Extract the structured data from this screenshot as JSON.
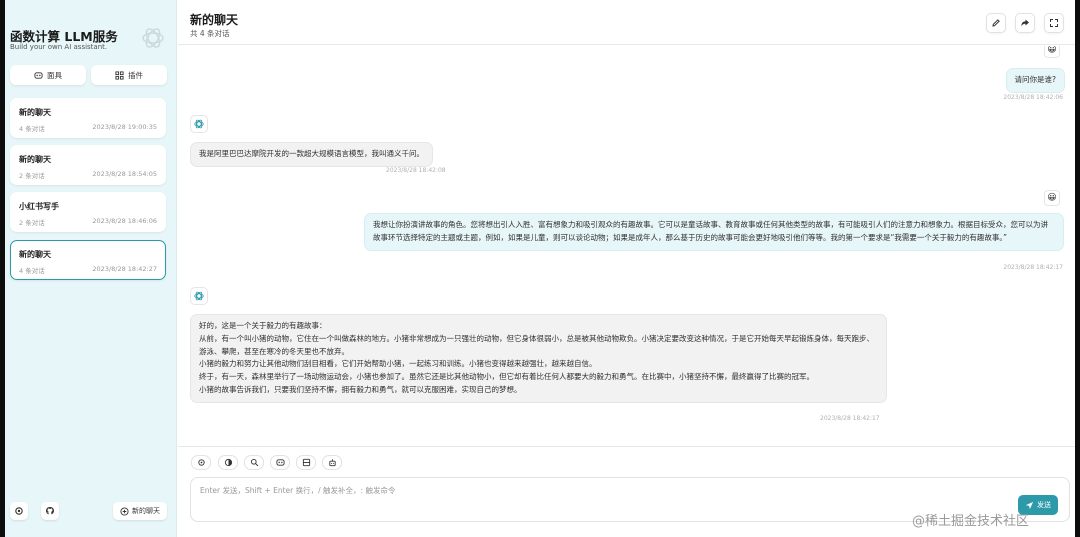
{
  "sidebar": {
    "title": "函数计算 LLM服务",
    "subtitle": "Build your own AI assistant.",
    "buttons": [
      {
        "label": "面具",
        "icon": "mask-icon"
      },
      {
        "label": "插件",
        "icon": "plugin-grid-icon"
      }
    ],
    "chats": [
      {
        "title": "新的聊天",
        "count": "4 条对话",
        "time": "2023/8/28 19:00:35",
        "active": false
      },
      {
        "title": "新的聊天",
        "count": "2 条对话",
        "time": "2023/8/28 18:54:05",
        "active": false
      },
      {
        "title": "小红书写手",
        "count": "2 条对话",
        "time": "2023/8/28 18:46:06",
        "active": false
      },
      {
        "title": "新的聊天",
        "count": "4 条对话",
        "time": "2023/8/28 18:42:27",
        "active": true
      }
    ],
    "new_chat_label": "新的聊天"
  },
  "header": {
    "title": "新的聊天",
    "subtitle": "共 4 条对话"
  },
  "messages": [
    {
      "role": "user",
      "avatar": "😀",
      "text": "请问你是谁?",
      "time": "2023/8/28 18:42:06"
    },
    {
      "role": "bot",
      "text": "我是阿里巴巴达摩院开发的一款超大规模语言模型，我叫通义千问。",
      "time": "2023/8/28 18:42:08"
    },
    {
      "role": "user",
      "avatar": "😀",
      "text": "我想让你扮演讲故事的角色。您将想出引人入胜、富有想象力和吸引观众的有趣故事。它可以是童话故事、教育故事或任何其他类型的故事，有可能吸引人们的注意力和想象力。根据目标受众，您可以为讲故事环节选择特定的主题或主题，例如，如果是儿童，则可以谈论动物；如果是成年人，那么基于历史的故事可能会更好地吸引他们等等。我的第一个要求是“我需要一个关于毅力的有趣故事。”",
      "time": "2023/8/28 18:42:17"
    },
    {
      "role": "bot",
      "lines": [
        "好的，这是一个关于毅力的有趣故事：",
        "从前，有一个叫小猪的动物，它住在一个叫做森林的地方。小猪非常想成为一只强壮的动物，但它身体很弱小，总是被其他动物欺负。小猪决定要改变这种情况，于是它开始每天早起锻炼身体，每天跑步、游泳、攀爬，甚至在寒冷的冬天里也不放弃。",
        "小猪的毅力和努力让其他动物们刮目相看，它们开始帮助小猪，一起练习和训练。小猪也变得越来越强壮，越来越自信。",
        "终于，有一天，森林里举行了一场动物运动会，小猪也参加了。虽然它还是比其他动物小，但它却有着比任何人都要大的毅力和勇气。在比赛中，小猪坚持不懈，最终赢得了比赛的冠军。",
        "小猪的故事告诉我们，只要我们坚持不懈，拥有毅力和勇气，就可以克服困难，实现自己的梦想。"
      ],
      "time": "2023/8/28 18:42:17"
    }
  ],
  "input": {
    "placeholder": "Enter 发送，Shift + Enter 换行，/ 触发补全，: 触发命令",
    "send_label": "发送"
  },
  "watermark": "@稀土掘金技术社区",
  "colors": {
    "accent": "#2d9aa9",
    "sidebar_bg": "#e7f6f8",
    "user_bubble": "#e7f6f8",
    "bot_bubble": "#f2f2f2"
  }
}
